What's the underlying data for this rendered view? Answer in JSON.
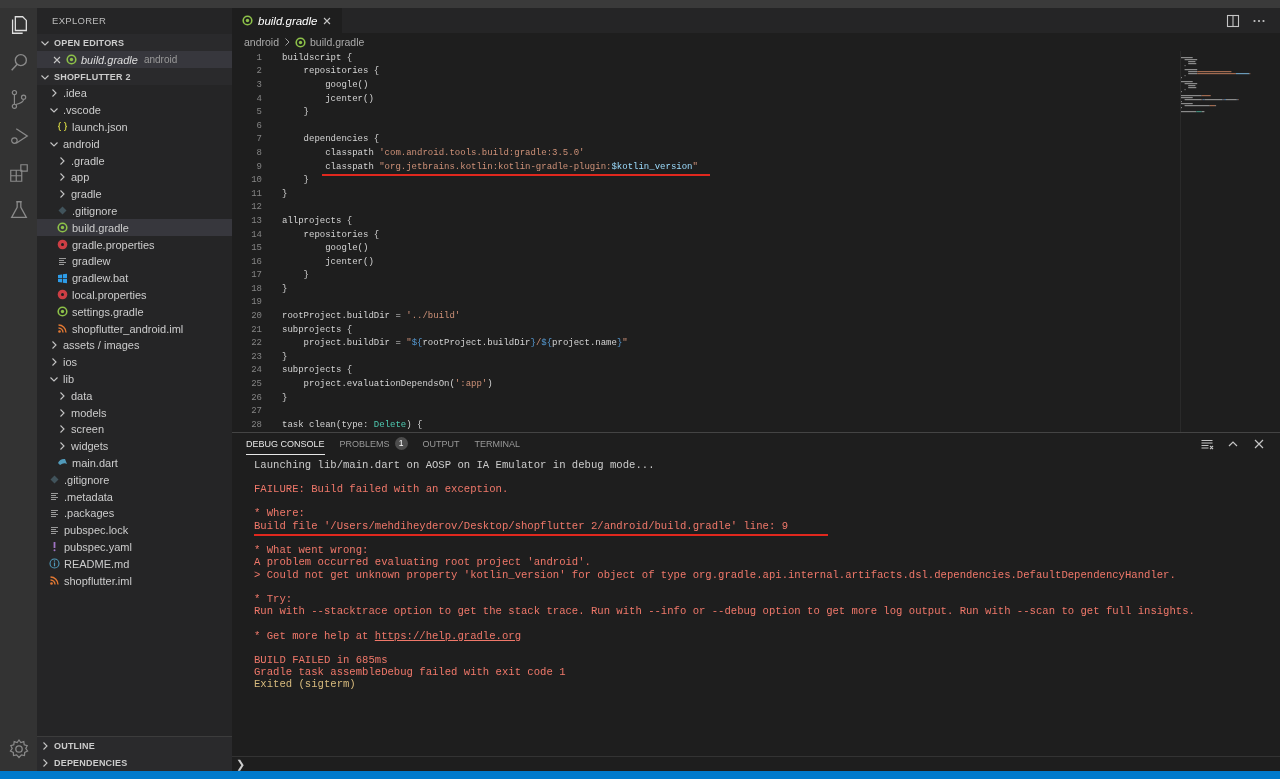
{
  "sidebar": {
    "title": "EXPLORER",
    "open_editors": {
      "label": "OPEN EDITORS",
      "expanded": true,
      "items": [
        {
          "name": "build.gradle",
          "description": "android",
          "kind": "gradle",
          "italic": true
        }
      ]
    },
    "workspace": {
      "label": "SHOPFLUTTER 2",
      "expanded": true,
      "tree": [
        {
          "label": ".idea",
          "kind": "folder",
          "expanded": false,
          "selected": false
        },
        {
          "label": ".vscode",
          "kind": "folder",
          "expanded": true,
          "selected": false,
          "children": [
            {
              "label": "launch.json",
              "kind": "json",
              "selected": false
            }
          ]
        },
        {
          "label": "android",
          "kind": "folder",
          "expanded": true,
          "selected": false,
          "children": [
            {
              "label": ".gradle",
              "kind": "folder",
              "expanded": false,
              "selected": false
            },
            {
              "label": "app",
              "kind": "folder",
              "expanded": false,
              "selected": false
            },
            {
              "label": "gradle",
              "kind": "folder",
              "expanded": false,
              "selected": false
            },
            {
              "label": ".gitignore",
              "kind": "git",
              "selected": false
            },
            {
              "label": "build.gradle",
              "kind": "gradle",
              "selected": true
            },
            {
              "label": "gradle.properties",
              "kind": "props",
              "selected": false
            },
            {
              "label": "gradlew",
              "kind": "lines",
              "selected": false
            },
            {
              "label": "gradlew.bat",
              "kind": "windows",
              "selected": false
            },
            {
              "label": "local.properties",
              "kind": "props",
              "selected": false
            },
            {
              "label": "settings.gradle",
              "kind": "gradle",
              "selected": false
            },
            {
              "label": "shopflutter_android.iml",
              "kind": "feed",
              "selected": false
            }
          ]
        },
        {
          "label": "assets / images",
          "kind": "folder",
          "expanded": false,
          "selected": false
        },
        {
          "label": "ios",
          "kind": "folder",
          "expanded": false,
          "selected": false
        },
        {
          "label": "lib",
          "kind": "folder",
          "expanded": true,
          "selected": false,
          "children": [
            {
              "label": "data",
              "kind": "folder",
              "expanded": false,
              "selected": false
            },
            {
              "label": "models",
              "kind": "folder",
              "expanded": false,
              "selected": false
            },
            {
              "label": "screen",
              "kind": "folder",
              "expanded": false,
              "selected": false
            },
            {
              "label": "widgets",
              "kind": "folder",
              "expanded": false,
              "selected": false
            },
            {
              "label": "main.dart",
              "kind": "dart",
              "selected": false
            }
          ]
        },
        {
          "label": ".gitignore",
          "kind": "git",
          "selected": false
        },
        {
          "label": ".metadata",
          "kind": "lines",
          "selected": false
        },
        {
          "label": ".packages",
          "kind": "lines",
          "selected": false
        },
        {
          "label": "pubspec.lock",
          "kind": "lines",
          "selected": false
        },
        {
          "label": "pubspec.yaml",
          "kind": "yaml",
          "selected": false
        },
        {
          "label": "README.md",
          "kind": "info",
          "selected": false
        },
        {
          "label": "shopflutter.iml",
          "kind": "feed",
          "selected": false
        }
      ]
    },
    "bottom_sections": [
      {
        "label": "OUTLINE",
        "expanded": false
      },
      {
        "label": "DEPENDENCIES",
        "expanded": false
      }
    ]
  },
  "editor": {
    "tabs": [
      {
        "label": "build.gradle",
        "kind": "gradle",
        "italic": true,
        "selected": true
      }
    ],
    "breadcrumb": [
      {
        "label": "android",
        "kind": "folder"
      },
      {
        "label": "build.gradle",
        "kind": "gradle"
      }
    ],
    "lines": [
      {
        "n": "1",
        "tokens": [
          {
            "text": "buildscript {",
            "kind": "plain"
          }
        ]
      },
      {
        "n": "2",
        "tokens": [
          {
            "text": "    repositories {",
            "kind": "plain"
          }
        ]
      },
      {
        "n": "3",
        "tokens": [
          {
            "text": "        google()",
            "kind": "plain"
          }
        ]
      },
      {
        "n": "4",
        "tokens": [
          {
            "text": "        jcenter()",
            "kind": "plain"
          }
        ]
      },
      {
        "n": "5",
        "tokens": [
          {
            "text": "    }",
            "kind": "plain"
          }
        ]
      },
      {
        "n": "6"
      },
      {
        "n": "7",
        "tokens": [
          {
            "text": "    dependencies {",
            "kind": "plain"
          }
        ]
      },
      {
        "n": "8",
        "tokens": [
          {
            "text": "        classpath ",
            "kind": "plain"
          },
          {
            "text": "'com.android.tools.build:gradle:3.5.0'",
            "kind": "string"
          }
        ]
      },
      {
        "n": "9",
        "underlined": true,
        "tokens": [
          {
            "text": "        classpath ",
            "kind": "plain"
          },
          {
            "text": "\"org.jetbrains.kotlin:kotlin-gradle-plugin:",
            "kind": "string"
          },
          {
            "text": "$kotlin_version",
            "kind": "variable"
          },
          {
            "text": "\"",
            "kind": "string"
          }
        ]
      },
      {
        "n": "10",
        "tokens": [
          {
            "text": "    }",
            "kind": "plain"
          }
        ]
      },
      {
        "n": "11",
        "tokens": [
          {
            "text": "}",
            "kind": "plain"
          }
        ]
      },
      {
        "n": "12"
      },
      {
        "n": "13",
        "tokens": [
          {
            "text": "allprojects {",
            "kind": "plain"
          }
        ]
      },
      {
        "n": "14",
        "tokens": [
          {
            "text": "    repositories {",
            "kind": "plain"
          }
        ]
      },
      {
        "n": "15",
        "tokens": [
          {
            "text": "        google()",
            "kind": "plain"
          }
        ]
      },
      {
        "n": "16",
        "tokens": [
          {
            "text": "        jcenter()",
            "kind": "plain"
          }
        ]
      },
      {
        "n": "17",
        "tokens": [
          {
            "text": "    }",
            "kind": "plain"
          }
        ]
      },
      {
        "n": "18",
        "tokens": [
          {
            "text": "}",
            "kind": "plain"
          }
        ]
      },
      {
        "n": "19"
      },
      {
        "n": "20",
        "tokens": [
          {
            "text": "rootProject.buildDir = ",
            "kind": "plain"
          },
          {
            "text": "'../build'",
            "kind": "string"
          }
        ]
      },
      {
        "n": "21",
        "tokens": [
          {
            "text": "subprojects {",
            "kind": "plain"
          }
        ]
      },
      {
        "n": "22",
        "tokens": [
          {
            "text": "    project.buildDir = ",
            "kind": "plain"
          },
          {
            "text": "\"",
            "kind": "string"
          },
          {
            "text": "${",
            "kind": "keyword"
          },
          {
            "text": "rootProject.buildDir",
            "kind": "plain"
          },
          {
            "text": "}",
            "kind": "keyword"
          },
          {
            "text": "/",
            "kind": "string"
          },
          {
            "text": "${",
            "kind": "keyword"
          },
          {
            "text": "project.name",
            "kind": "plain"
          },
          {
            "text": "}",
            "kind": "keyword"
          },
          {
            "text": "\"",
            "kind": "string"
          }
        ]
      },
      {
        "n": "23",
        "tokens": [
          {
            "text": "}",
            "kind": "plain"
          }
        ]
      },
      {
        "n": "24",
        "tokens": [
          {
            "text": "subprojects {",
            "kind": "plain"
          }
        ]
      },
      {
        "n": "25",
        "tokens": [
          {
            "text": "    project.evaluationDependsOn(",
            "kind": "plain"
          },
          {
            "text": "':app'",
            "kind": "string"
          },
          {
            "text": ")",
            "kind": "plain"
          }
        ]
      },
      {
        "n": "26",
        "tokens": [
          {
            "text": "}",
            "kind": "plain"
          }
        ]
      },
      {
        "n": "27"
      },
      {
        "n": "28",
        "tokens": [
          {
            "text": "task clean(type: ",
            "kind": "plain"
          },
          {
            "text": "Delete",
            "kind": "type"
          },
          {
            "text": ") {",
            "kind": "plain"
          }
        ]
      }
    ]
  },
  "panel": {
    "tabs": [
      {
        "label": "DEBUG CONSOLE",
        "selected": true
      },
      {
        "label": "PROBLEMS",
        "badge": "1",
        "selected": false
      },
      {
        "label": "OUTPUT",
        "selected": false
      },
      {
        "label": "TERMINAL",
        "selected": false
      }
    ],
    "console": [
      {
        "kind": "info",
        "text": "Launching lib/main.dart on AOSP on IA Emulator in debug mode..."
      },
      {
        "kind": "error",
        "gap": true,
        "text": "FAILURE: Build failed with an exception."
      },
      {
        "kind": "error",
        "gap": true,
        "text": "* Where:"
      },
      {
        "kind": "error",
        "underlined": true,
        "text": "Build file '/Users/mehdiheyderov/Desktop/shopflutter 2/android/build.gradle' line: 9"
      },
      {
        "kind": "error",
        "gap": true,
        "text": "* What went wrong:"
      },
      {
        "kind": "error",
        "text": "A problem occurred evaluating root project 'android'."
      },
      {
        "kind": "error",
        "text": "> Could not get unknown property 'kotlin_version' for object of type org.gradle.api.internal.artifacts.dsl.dependencies.DefaultDependencyHandler."
      },
      {
        "kind": "error",
        "gap": true,
        "text": "* Try:"
      },
      {
        "kind": "error",
        "text": "Run with --stacktrace option to get the stack trace. Run with --info or --debug option to get more log output. Run with --scan to get full insights."
      },
      {
        "kind": "error",
        "gap": true,
        "text": "* Get more help at ",
        "link": "https://help.gradle.org"
      },
      {
        "kind": "error",
        "gap": true,
        "text": "BUILD FAILED in 685ms"
      },
      {
        "kind": "error",
        "text": "Gradle task assembleDebug failed with exit code 1"
      },
      {
        "kind": "warning",
        "text": "Exited (sigterm)"
      }
    ],
    "prompt": "❯"
  }
}
